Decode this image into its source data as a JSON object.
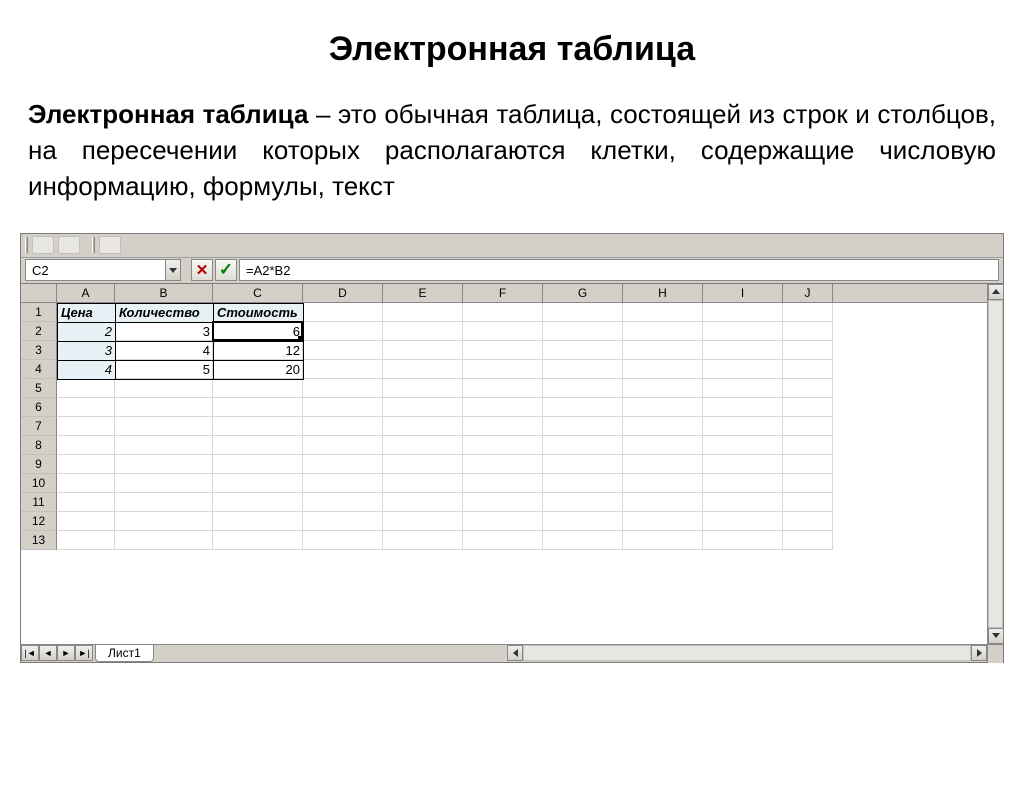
{
  "title": "Электронная таблица",
  "desc_term": "Электронная таблица",
  "desc_rest": " – это обычная таблица, состоящей из строк и столбцов, на пересечении которых располагаются клетки, содержащие числовую информацию, формулы, текст",
  "namebox": "C2",
  "formula": "=A2*B2",
  "cancel_glyph": "✕",
  "accept_glyph": "✓",
  "columns": [
    "A",
    "B",
    "C",
    "D",
    "E",
    "F",
    "G",
    "H",
    "I",
    "J"
  ],
  "rows": [
    1,
    2,
    3,
    4,
    5,
    6,
    7,
    8,
    9,
    10,
    11,
    12,
    13
  ],
  "table": {
    "headers": [
      "Цена",
      "Количество",
      "Стоимость"
    ],
    "data": [
      [
        "2",
        "3",
        "6"
      ],
      [
        "3",
        "4",
        "12"
      ],
      [
        "4",
        "5",
        "20"
      ]
    ]
  },
  "sheet_tab": "Лист1",
  "nav": {
    "first": "|◄",
    "prev": "◄",
    "next": "►",
    "last": "►|"
  }
}
